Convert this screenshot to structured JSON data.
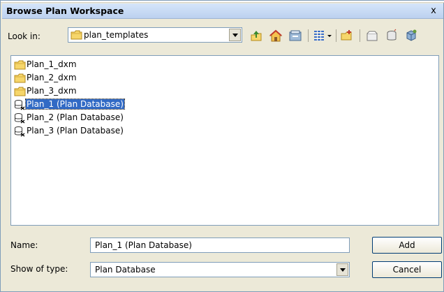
{
  "window": {
    "title": "Browse Plan Workspace",
    "close_glyph": "x"
  },
  "lookin": {
    "label": "Look in:",
    "value": "plan_templates"
  },
  "toolbar": {
    "icons": [
      "up-one-level-icon",
      "home-icon",
      "connect-folder-icon",
      "view-menu-icon",
      "new-folder-icon",
      "new-workspace-icon",
      "new-database-icon",
      "options-icon"
    ]
  },
  "files": [
    {
      "label": "Plan_1_dxm",
      "kind": "folder",
      "selected": false
    },
    {
      "label": "Plan_2_dxm",
      "kind": "folder",
      "selected": false
    },
    {
      "label": "Plan_3_dxm",
      "kind": "folder",
      "selected": false
    },
    {
      "label": "Plan_1 (Plan Database)",
      "kind": "database",
      "selected": true
    },
    {
      "label": "Plan_2 (Plan Database)",
      "kind": "database",
      "selected": false
    },
    {
      "label": "Plan_3 (Plan Database)",
      "kind": "database",
      "selected": false
    }
  ],
  "form": {
    "name_label": "Name:",
    "name_value": "Plan_1 (Plan Database)",
    "type_label": "Show of type:",
    "type_value": "Plan Database"
  },
  "buttons": {
    "add": "Add",
    "cancel": "Cancel"
  },
  "colors": {
    "selection": "#316ac5",
    "titlebar": "#c8dbf5"
  }
}
